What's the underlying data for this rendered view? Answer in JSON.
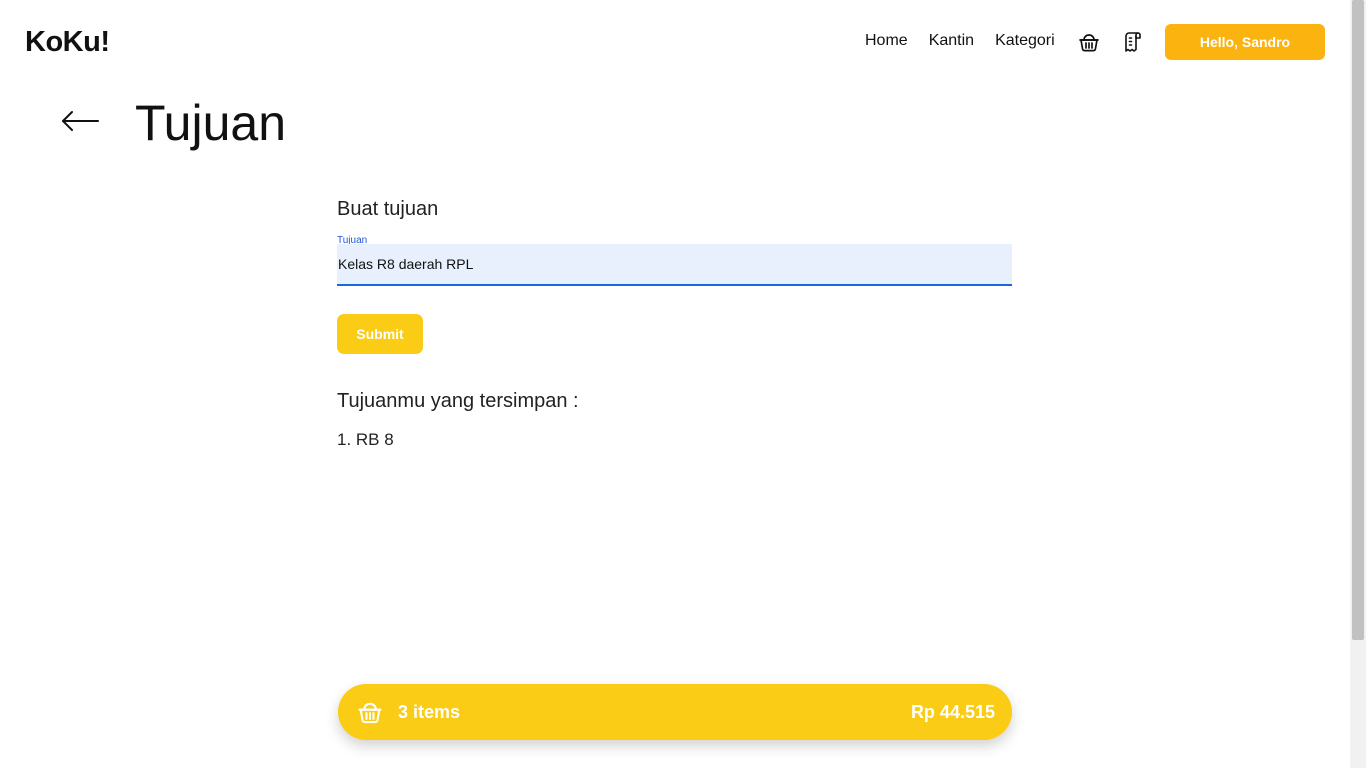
{
  "navbar": {
    "brand": "KoKu!",
    "links": [
      "Home",
      "Kantin",
      "Kategori"
    ],
    "greeting_button": "Hello, Sandro",
    "icons": [
      "basket-icon",
      "receipt-icon"
    ]
  },
  "page": {
    "title": "Tujuan",
    "back_icon": "arrow-left-icon"
  },
  "form": {
    "heading": "Buat tujuan",
    "field_label": "Tujuan",
    "field_value": "Kelas R8 daerah RPL",
    "submit_label": "Submit"
  },
  "saved": {
    "heading": "Tujuanmu yang tersimpan :",
    "items": [
      "1. RB 8"
    ]
  },
  "cart": {
    "count_label": "3 items",
    "total_label": "Rp 44.515",
    "icon": "basket-icon"
  },
  "colors": {
    "accent_yellow": "#facc15",
    "greeting_yellow": "#fbb40f",
    "input_bg": "#e8f0fe",
    "input_border": "#1a66e0"
  }
}
